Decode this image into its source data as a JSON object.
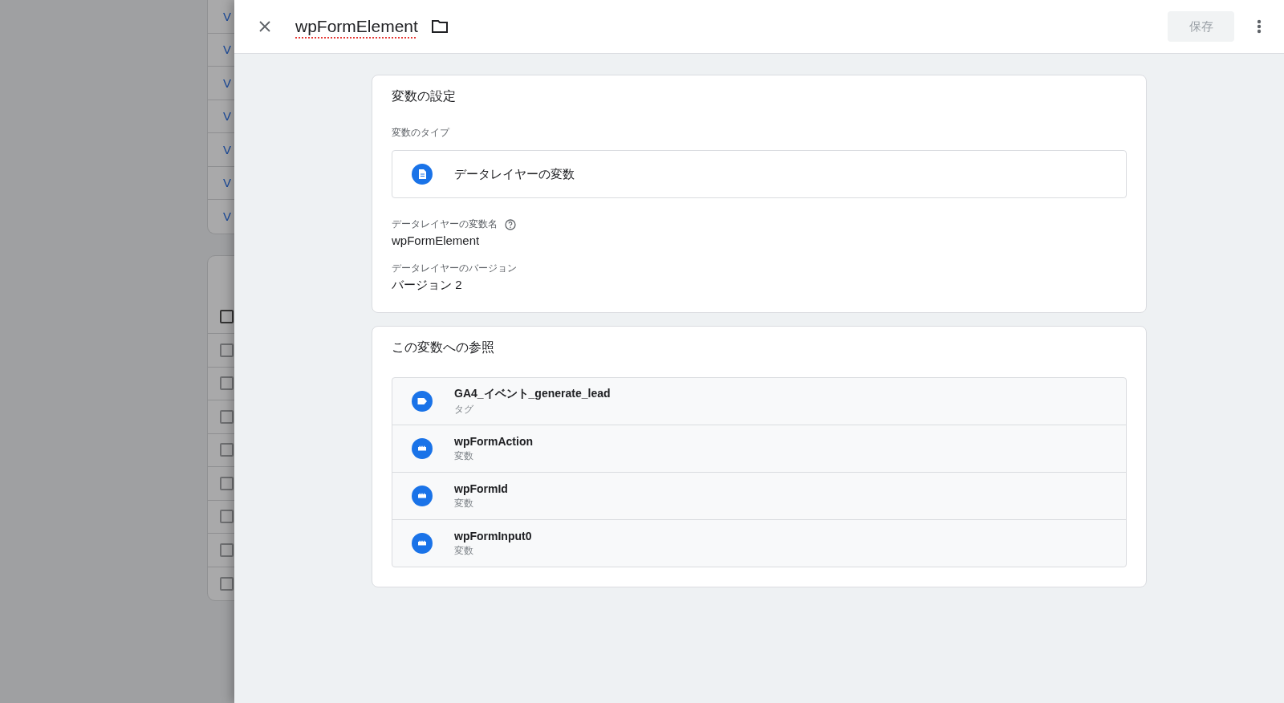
{
  "background_page": {
    "links": [
      "V",
      "V",
      "V",
      "V",
      "V",
      "V",
      "V"
    ],
    "checkboxes": [
      {
        "checked": false
      },
      {
        "checked": false
      },
      {
        "checked": false
      },
      {
        "checked": false
      },
      {
        "checked": false
      },
      {
        "checked": false
      },
      {
        "checked": false
      },
      {
        "checked": false
      },
      {
        "checked": false
      }
    ]
  },
  "header": {
    "title": "wpFormElement",
    "save_button": {
      "label": "保存",
      "disabled": true
    }
  },
  "config_card": {
    "title": "変数の設定",
    "type_label": "変数のタイプ",
    "type_value": "データレイヤーの変数",
    "fields": [
      {
        "label": "データレイヤーの変数名",
        "help": true,
        "value": "wpFormElement"
      },
      {
        "label": "データレイヤーのバージョン",
        "help": false,
        "value": "バージョン 2"
      }
    ]
  },
  "references_card": {
    "title": "この変数への参照",
    "items": [
      {
        "kind": "tag",
        "name": "GA4_イベント_generate_lead",
        "type": "タグ"
      },
      {
        "kind": "variable",
        "name": "wpFormAction",
        "type": "変数"
      },
      {
        "kind": "variable",
        "name": "wpFormId",
        "type": "変数"
      },
      {
        "kind": "variable",
        "name": "wpFormInput0",
        "type": "変数"
      }
    ]
  }
}
